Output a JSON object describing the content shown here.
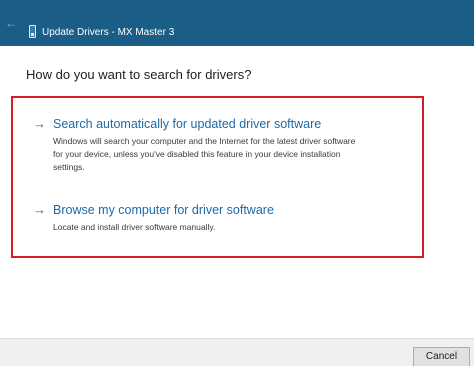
{
  "titlebar": {
    "back_icon": "back-arrow-icon",
    "device_icon": "usb-device-icon",
    "title": "Update Drivers - MX Master 3"
  },
  "heading": "How do you want to search for drivers?",
  "options": [
    {
      "icon": "right-arrow-icon",
      "arrow": "→",
      "title": "Search automatically for updated driver software",
      "description_lines": [
        "Windows will search your computer and the Internet for the latest driver software",
        "for your device, unless you've disabled this feature in your device installation",
        "settings."
      ]
    },
    {
      "icon": "right-arrow-icon",
      "arrow": "→",
      "title": "Browse my computer for driver software",
      "description_lines": [
        "Locate and install driver software manually."
      ]
    }
  ],
  "footer": {
    "cancel_label": "Cancel"
  },
  "colors": {
    "titlebar": "#1a5d86",
    "link": "#1c6aa8",
    "highlight": "#d51d27"
  }
}
